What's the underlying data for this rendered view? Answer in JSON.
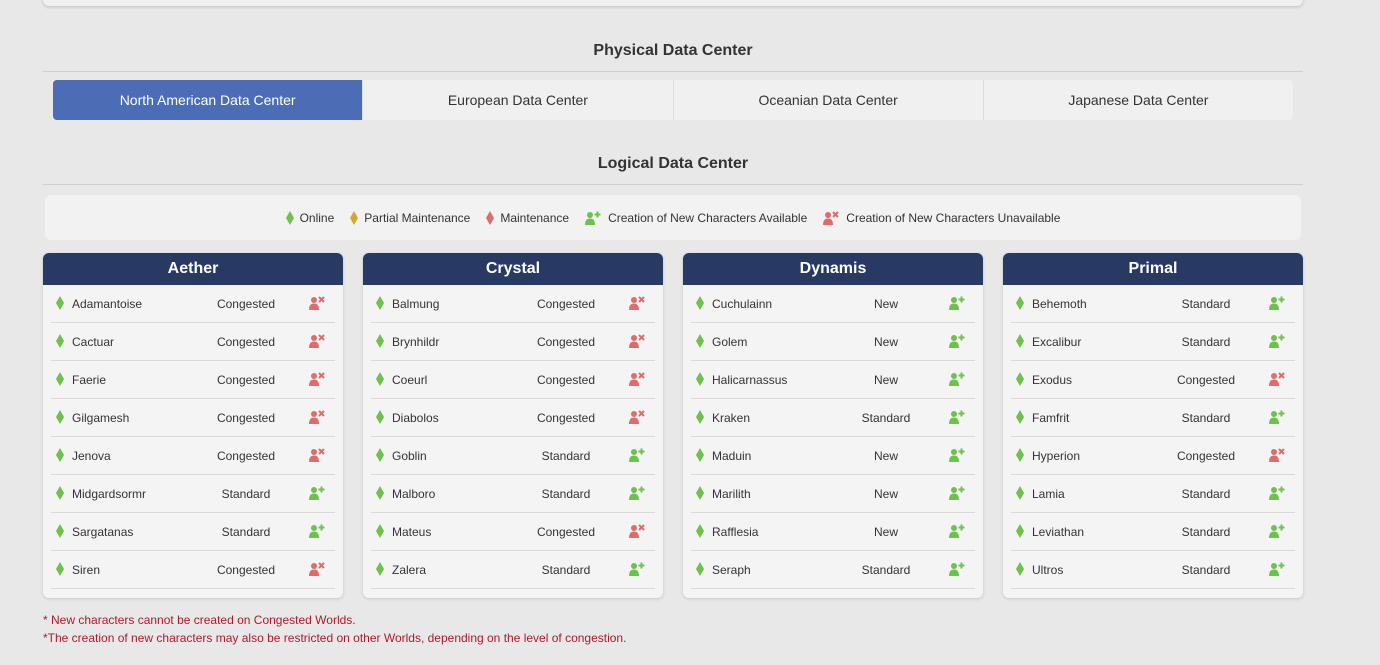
{
  "physical_title": "Physical Data Center",
  "logical_title": "Logical Data Center",
  "tabs": [
    {
      "label": "North American Data Center",
      "active": true
    },
    {
      "label": "European Data Center",
      "active": false
    },
    {
      "label": "Oceanian Data Center",
      "active": false
    },
    {
      "label": "Japanese Data Center",
      "active": false
    }
  ],
  "legend": {
    "online": "Online",
    "partial": "Partial Maintenance",
    "maintenance": "Maintenance",
    "available": "Creation of New Characters Available",
    "unavailable": "Creation of New Characters Unavailable"
  },
  "colors": {
    "online": "#6cc24a",
    "partial": "#d4a82a",
    "maintenance": "#e06b6b",
    "available": "#6cc24a",
    "unavailable": "#e06b6b",
    "active_tab": "#4a6db5",
    "header": "#283a63"
  },
  "data_centers": [
    {
      "name": "Aether",
      "worlds": [
        {
          "name": "Adamantoise",
          "category": "Congested",
          "creation": "unavailable"
        },
        {
          "name": "Cactuar",
          "category": "Congested",
          "creation": "unavailable"
        },
        {
          "name": "Faerie",
          "category": "Congested",
          "creation": "unavailable"
        },
        {
          "name": "Gilgamesh",
          "category": "Congested",
          "creation": "unavailable"
        },
        {
          "name": "Jenova",
          "category": "Congested",
          "creation": "unavailable"
        },
        {
          "name": "Midgardsormr",
          "category": "Standard",
          "creation": "available"
        },
        {
          "name": "Sargatanas",
          "category": "Standard",
          "creation": "available"
        },
        {
          "name": "Siren",
          "category": "Congested",
          "creation": "unavailable"
        }
      ]
    },
    {
      "name": "Crystal",
      "worlds": [
        {
          "name": "Balmung",
          "category": "Congested",
          "creation": "unavailable"
        },
        {
          "name": "Brynhildr",
          "category": "Congested",
          "creation": "unavailable"
        },
        {
          "name": "Coeurl",
          "category": "Congested",
          "creation": "unavailable"
        },
        {
          "name": "Diabolos",
          "category": "Congested",
          "creation": "unavailable"
        },
        {
          "name": "Goblin",
          "category": "Standard",
          "creation": "available"
        },
        {
          "name": "Malboro",
          "category": "Standard",
          "creation": "available"
        },
        {
          "name": "Mateus",
          "category": "Congested",
          "creation": "unavailable"
        },
        {
          "name": "Zalera",
          "category": "Standard",
          "creation": "available"
        }
      ]
    },
    {
      "name": "Dynamis",
      "worlds": [
        {
          "name": "Cuchulainn",
          "category": "New",
          "creation": "available"
        },
        {
          "name": "Golem",
          "category": "New",
          "creation": "available"
        },
        {
          "name": "Halicarnassus",
          "category": "New",
          "creation": "available"
        },
        {
          "name": "Kraken",
          "category": "Standard",
          "creation": "available"
        },
        {
          "name": "Maduin",
          "category": "New",
          "creation": "available"
        },
        {
          "name": "Marilith",
          "category": "New",
          "creation": "available"
        },
        {
          "name": "Rafflesia",
          "category": "New",
          "creation": "available"
        },
        {
          "name": "Seraph",
          "category": "Standard",
          "creation": "available"
        }
      ]
    },
    {
      "name": "Primal",
      "worlds": [
        {
          "name": "Behemoth",
          "category": "Standard",
          "creation": "available"
        },
        {
          "name": "Excalibur",
          "category": "Standard",
          "creation": "available"
        },
        {
          "name": "Exodus",
          "category": "Congested",
          "creation": "unavailable"
        },
        {
          "name": "Famfrit",
          "category": "Standard",
          "creation": "available"
        },
        {
          "name": "Hyperion",
          "category": "Congested",
          "creation": "unavailable"
        },
        {
          "name": "Lamia",
          "category": "Standard",
          "creation": "available"
        },
        {
          "name": "Leviathan",
          "category": "Standard",
          "creation": "available"
        },
        {
          "name": "Ultros",
          "category": "Standard",
          "creation": "available"
        }
      ]
    }
  ],
  "notes": [
    "* New characters cannot be created on Congested Worlds.",
    "*The creation of new characters may also be restricted on other Worlds, depending on the level of congestion."
  ]
}
